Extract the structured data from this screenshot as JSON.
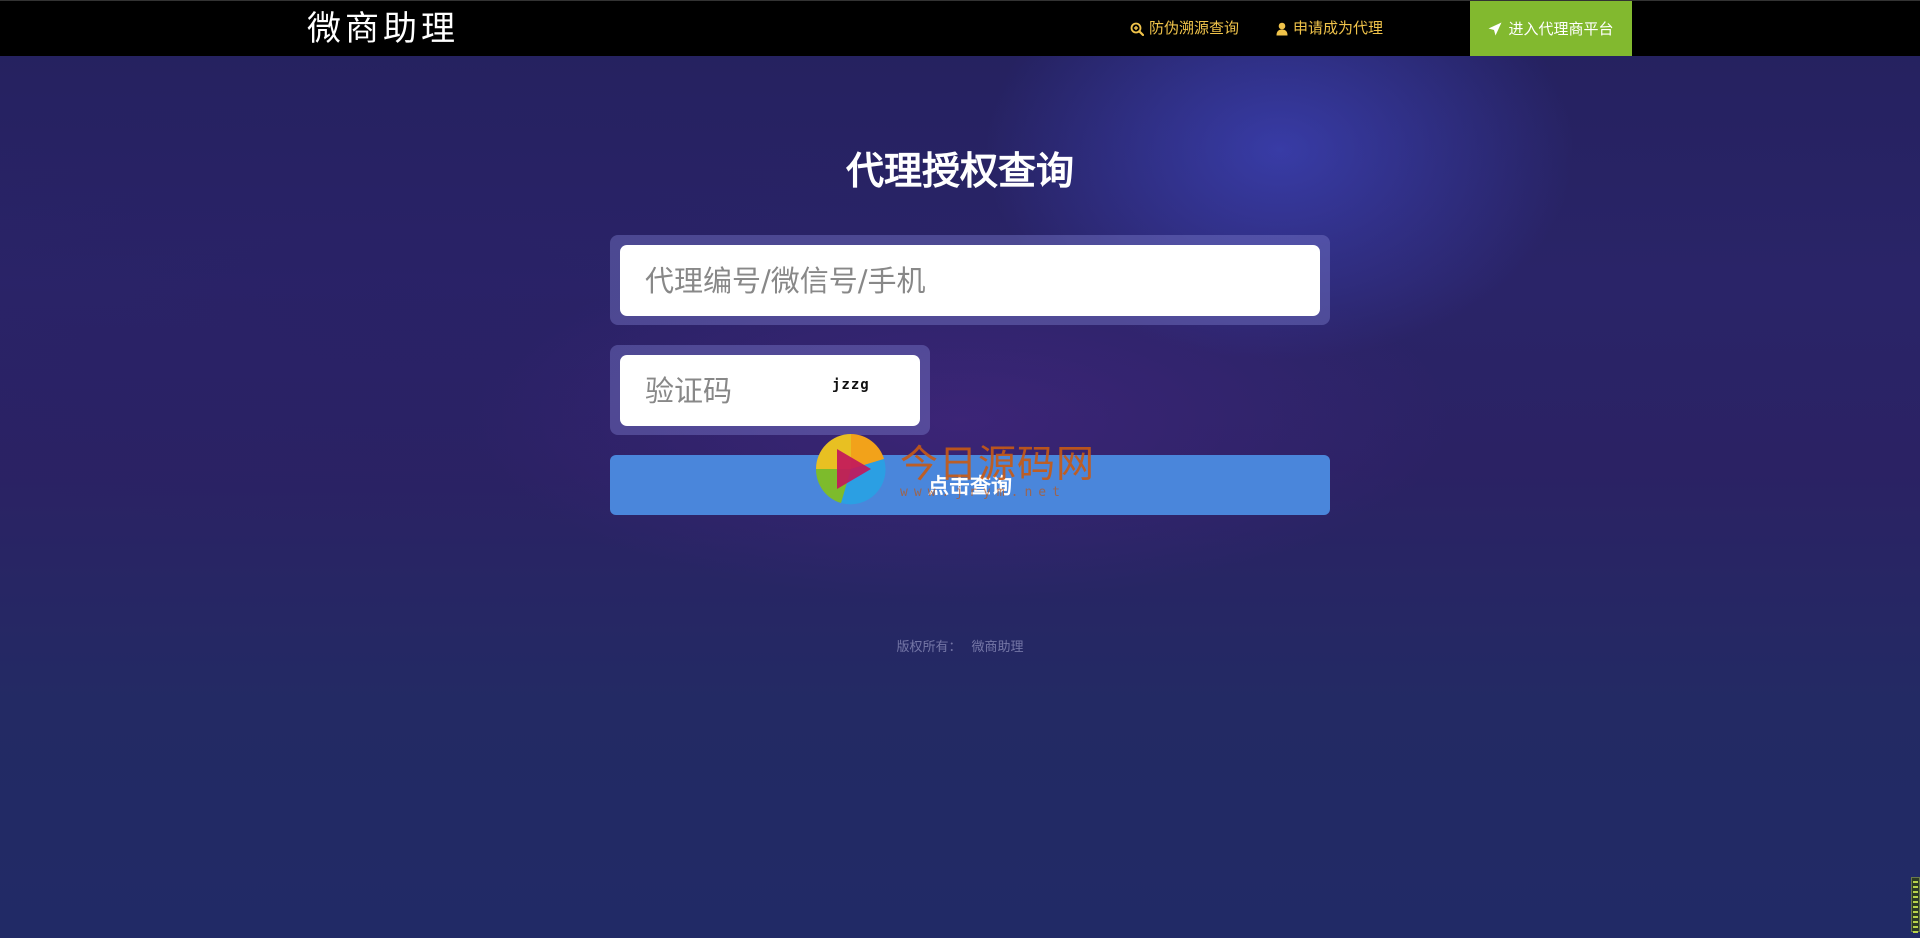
{
  "navbar": {
    "brand": "微商助理",
    "links": [
      {
        "label": "防伪溯源查询",
        "icon": "search-zoom-icon"
      },
      {
        "label": "申请成为代理",
        "icon": "user-icon"
      }
    ],
    "cta": {
      "label": "进入代理商平台",
      "icon": "rocket-icon"
    },
    "colors": {
      "link": "#f0c34a",
      "cta_bg": "#82b92f",
      "bar_bg": "#000000"
    }
  },
  "main": {
    "title": "代理授权查询",
    "id_input": {
      "placeholder": "代理编号/微信号/手机",
      "value": ""
    },
    "code_input": {
      "placeholder": "验证码",
      "value": ""
    },
    "captcha": "jzzg",
    "submit_label": "点击查询",
    "colors": {
      "submit_bg": "#4a86db"
    }
  },
  "watermark": {
    "text": "今日源码网",
    "sub": "www.jrym.net"
  },
  "footer": {
    "label": "版权所有：",
    "owner": "微商助理"
  }
}
